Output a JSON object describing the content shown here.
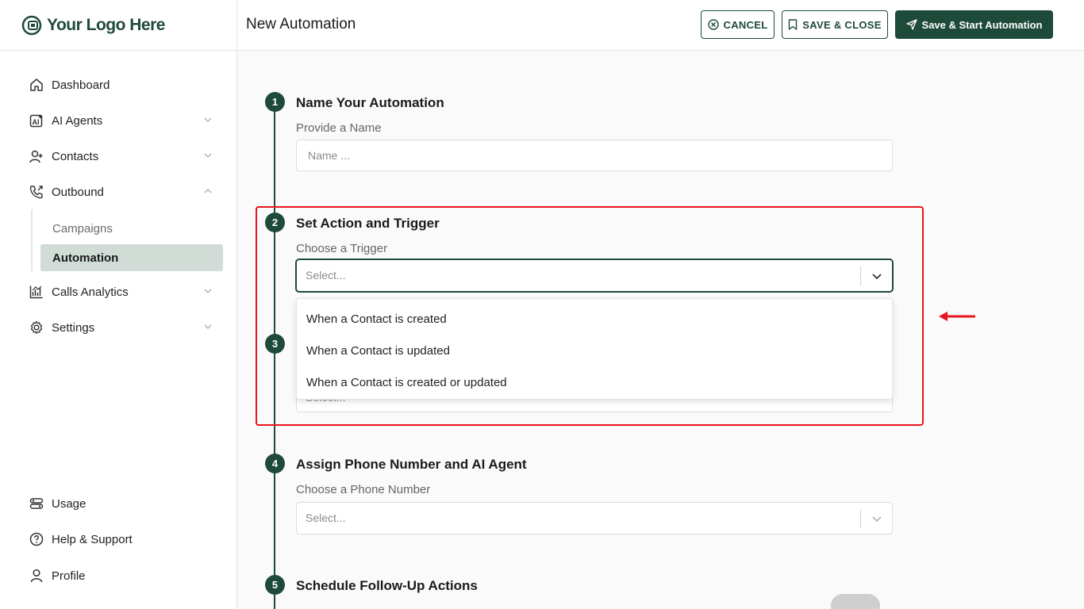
{
  "brand": {
    "logo_text": "Your Logo Here",
    "color": "#1e4a39"
  },
  "sidebar": {
    "items": [
      {
        "label": "Dashboard",
        "icon": "home-icon"
      },
      {
        "label": "AI Agents",
        "icon": "ai-icon"
      },
      {
        "label": "Contacts",
        "icon": "user-add-icon"
      },
      {
        "label": "Outbound",
        "icon": "phone-outgoing-icon"
      },
      {
        "label": "Calls Analytics",
        "icon": "chart-icon"
      },
      {
        "label": "Settings",
        "icon": "gear-icon"
      }
    ],
    "sub_items": [
      {
        "label": "Campaigns",
        "active": false
      },
      {
        "label": "Automation",
        "active": true
      }
    ],
    "footer_items": [
      {
        "label": "Usage",
        "icon": "toggle-icon"
      },
      {
        "label": "Help & Support",
        "icon": "help-circle-icon"
      },
      {
        "label": "Profile",
        "icon": "person-icon"
      }
    ]
  },
  "header": {
    "title": "New Automation",
    "cancel_label": "CANCEL",
    "save_close_label": "SAVE & CLOSE",
    "save_start_label": "Save & Start Automation"
  },
  "steps": [
    {
      "number": "1",
      "title": "Name Your Automation",
      "field_label": "Provide a Name",
      "placeholder": "Name ..."
    },
    {
      "number": "2",
      "title": "Set Action and Trigger",
      "field_label": "Choose a Trigger",
      "placeholder": "Select..."
    },
    {
      "number": "3",
      "title": "",
      "field_label": "",
      "placeholder": "Select..."
    },
    {
      "number": "4",
      "title": "Assign Phone Number and AI Agent",
      "field_label": "Choose a Phone Number",
      "placeholder": "Select..."
    },
    {
      "number": "5",
      "title": "Schedule Follow-Up Actions"
    }
  ],
  "trigger_options": [
    "When a Contact is created",
    "When a Contact is updated",
    "When a Contact is created or updated"
  ],
  "annotation_color": "#e8141c"
}
